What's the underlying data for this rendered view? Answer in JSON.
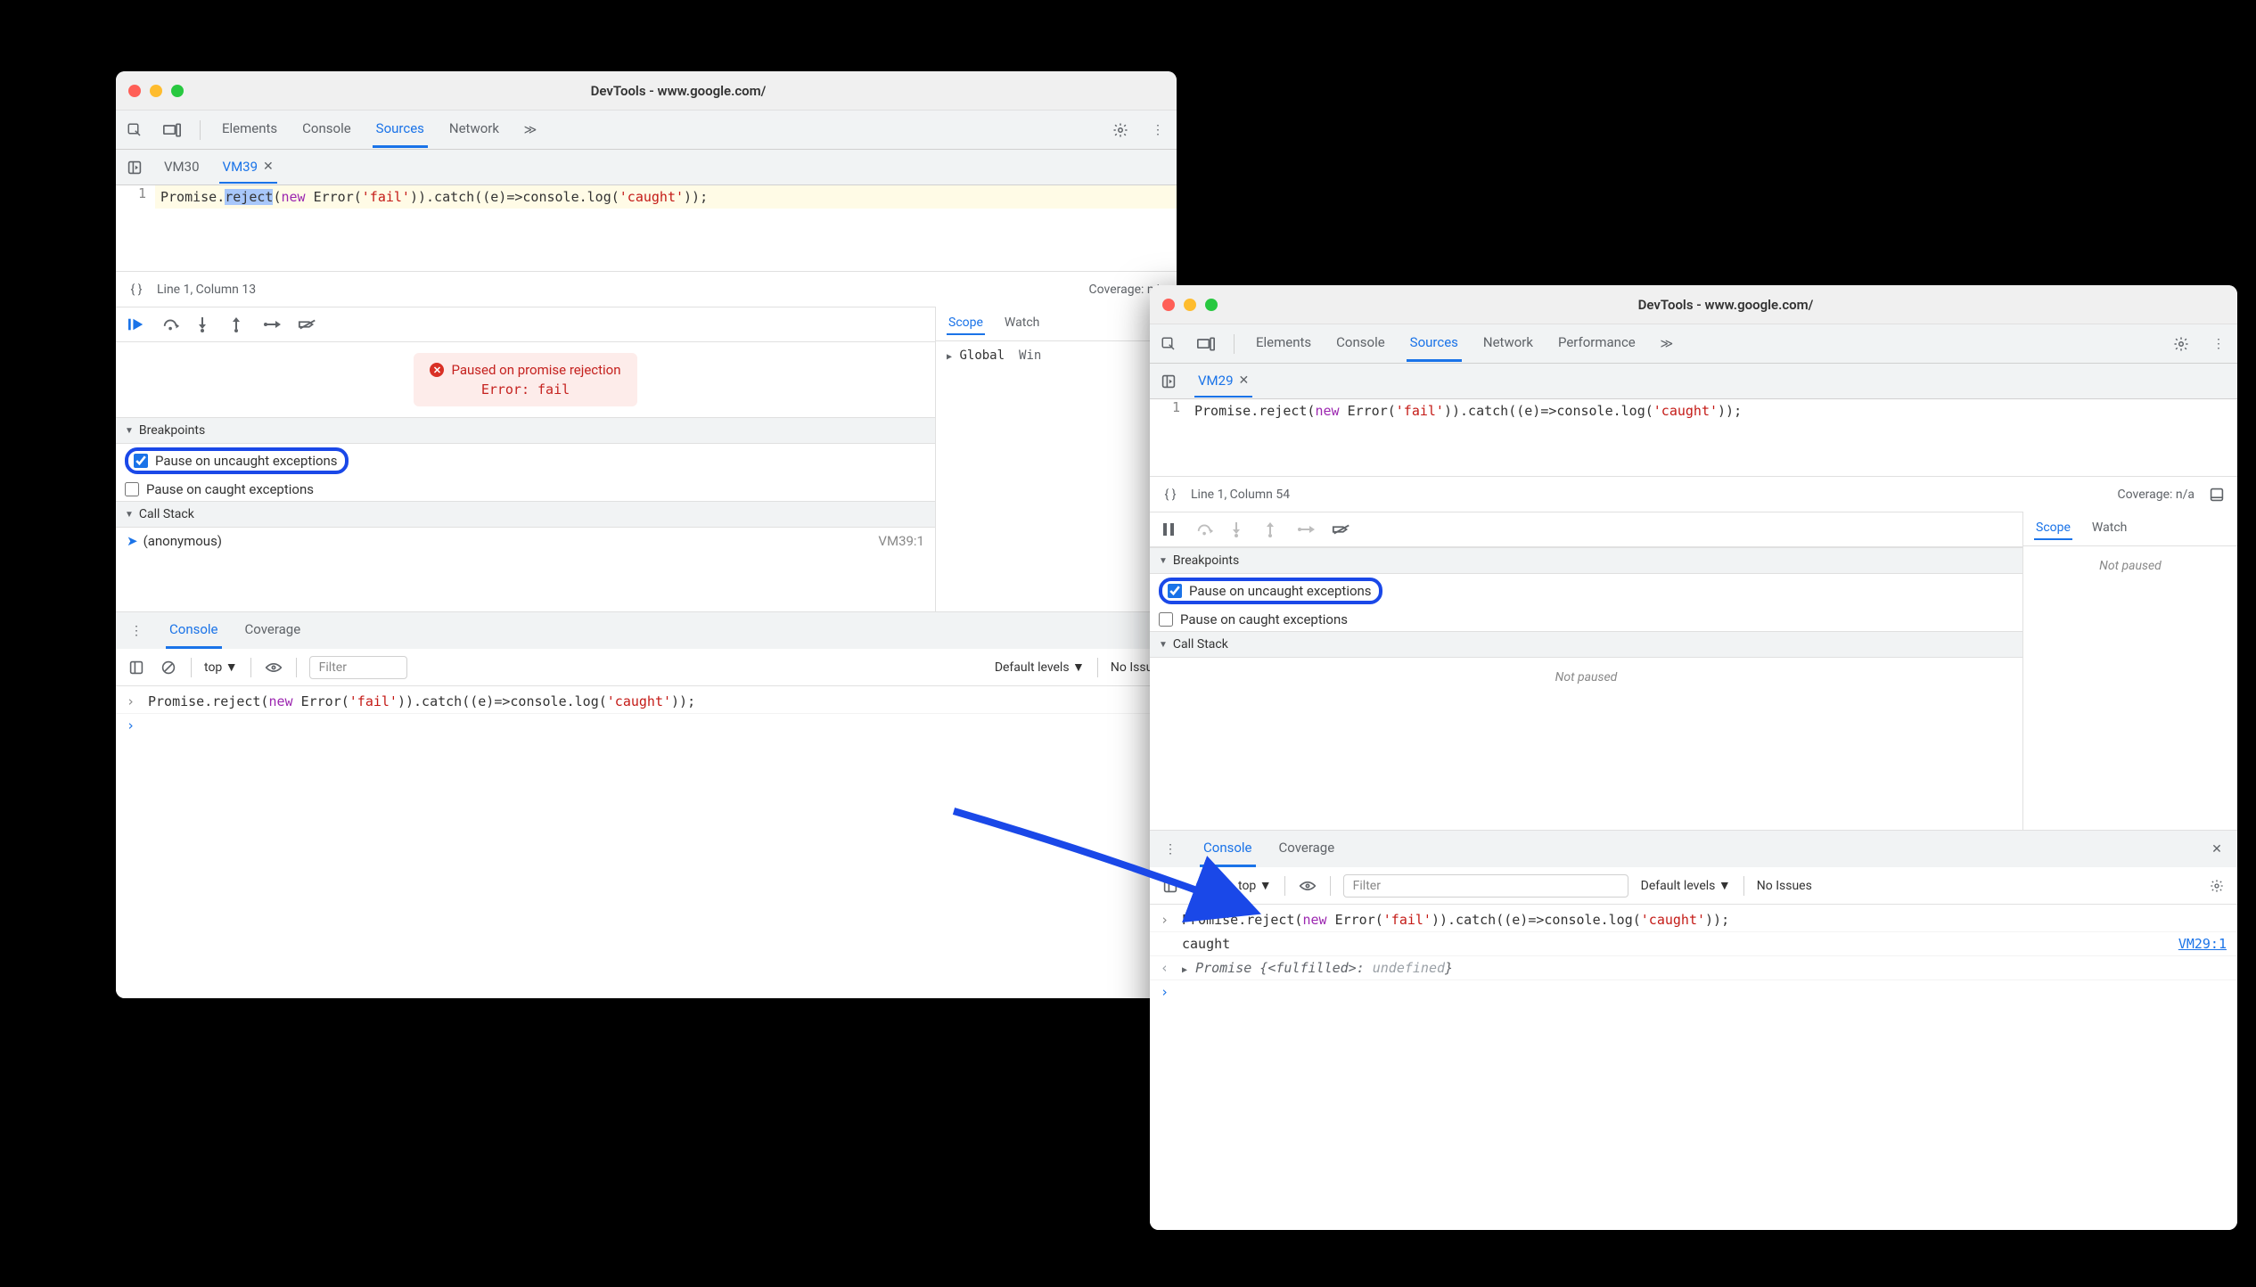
{
  "left": {
    "title": "DevTools - www.google.com/",
    "tabs": {
      "elements": "Elements",
      "console": "Console",
      "sources": "Sources",
      "network": "Network"
    },
    "fileTabs": {
      "inactive": "VM30",
      "active": "VM39"
    },
    "code": {
      "lineNum": "1",
      "pre": "Promise.",
      "sel": "reject",
      "mid1": "(",
      "newkw": "new",
      "mid2": " Error(",
      "str1": "'fail'",
      "mid3": ")).catch((e)=>console.log(",
      "str2": "'caught'",
      "mid4": "));"
    },
    "status": {
      "pos": "Line 1, Column 13",
      "coverage": "Coverage: n/a"
    },
    "pause": {
      "title": "Paused on promise rejection",
      "detail": "Error: fail"
    },
    "sections": {
      "breakpoints": "Breakpoints",
      "bpUncaught": "Pause on uncaught exceptions",
      "bpCaught": "Pause on caught exceptions",
      "callstack": "Call Stack",
      "stackItem": "(anonymous)",
      "stackSrc": "VM39:1"
    },
    "scope": {
      "tabScope": "Scope",
      "tabWatch": "Watch",
      "global": "Global",
      "win": "Win"
    },
    "drawer": {
      "console": "Console",
      "coverage": "Coverage"
    },
    "consoleTb": {
      "context": "top",
      "filter": "Filter",
      "levels": "Default levels",
      "issues": "No Issues"
    },
    "consoleLine": {
      "pre": "Promise.reject(",
      "newkw": "new",
      "mid1": " Error(",
      "str1": "'fail'",
      "mid2": ")).catch((e)=>console.log(",
      "str2": "'caught'",
      "mid3": "));"
    }
  },
  "right": {
    "title": "DevTools - www.google.com/",
    "tabs": {
      "elements": "Elements",
      "console": "Console",
      "sources": "Sources",
      "network": "Network",
      "performance": "Performance"
    },
    "fileTabs": {
      "active": "VM29"
    },
    "code": {
      "lineNum": "1",
      "pre": "Promise.reject(",
      "newkw": "new",
      "mid1": " Error(",
      "str1": "'fail'",
      "mid2": ")).catch((e)=>console.log(",
      "str2": "'caught'",
      "mid3": "));"
    },
    "status": {
      "pos": "Line 1, Column 54",
      "coverage": "Coverage: n/a"
    },
    "sections": {
      "breakpoints": "Breakpoints",
      "bpUncaught": "Pause on uncaught exceptions",
      "bpCaught": "Pause on caught exceptions",
      "callstack": "Call Stack",
      "notPaused": "Not paused"
    },
    "scope": {
      "tabScope": "Scope",
      "tabWatch": "Watch",
      "notPaused": "Not paused"
    },
    "drawer": {
      "console": "Console",
      "coverage": "Coverage"
    },
    "consoleTb": {
      "context": "top",
      "filter": "Filter",
      "levels": "Default levels",
      "issues": "No Issues"
    },
    "consoleLines": {
      "l1": {
        "pre": "Promise.reject(",
        "newkw": "new",
        "mid1": " Error(",
        "str1": "'fail'",
        "mid2": ")).catch((e)=>console.log(",
        "str2": "'caught'",
        "mid3": "));"
      },
      "l2": {
        "text": "caught",
        "src": "VM29:1"
      },
      "l3": {
        "pre": "Promise {",
        "state": "<fulfilled>",
        "sep": ": ",
        "val": "undefined",
        "post": "}"
      }
    }
  }
}
